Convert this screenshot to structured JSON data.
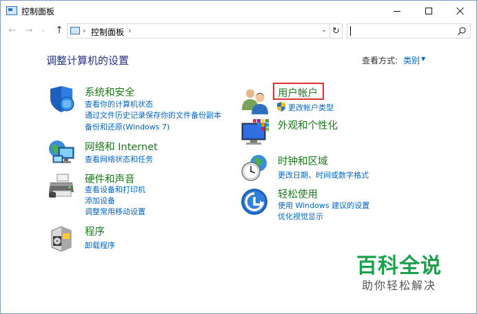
{
  "window": {
    "title": "控制面板"
  },
  "nav": {
    "address_path": "控制面板",
    "search_placeholder": ""
  },
  "header": {
    "title": "调整计算机的设置",
    "view_label": "查看方式:",
    "view_value": "类别"
  },
  "categories_left": [
    {
      "title": "系统和安全",
      "links": [
        "查看你的计算机状态",
        "通过文件历史记录保存你的文件备份副本",
        "备份和还原(Windows 7)"
      ]
    },
    {
      "title": "网络和 Internet",
      "links": [
        "查看网络状态和任务"
      ]
    },
    {
      "title": "硬件和声音",
      "links": [
        "查看设备和打印机",
        "添加设备",
        "调整常用移动设置"
      ]
    },
    {
      "title": "程序",
      "links": [
        "卸载程序"
      ]
    }
  ],
  "categories_right": [
    {
      "title": "用户帐户",
      "links": [
        "更改帐户类型"
      ]
    },
    {
      "title": "外观和个性化",
      "links": []
    },
    {
      "title": "时钟和区域",
      "links": [
        "更改日期、时间或数字格式"
      ]
    },
    {
      "title": "轻松使用",
      "links": [
        "使用 Windows 建议的设置",
        "优化视觉显示"
      ]
    }
  ],
  "watermark": {
    "brand": "百科全说",
    "tagline": "助你轻松解决"
  },
  "colors": {
    "category_title": "#1b7a1b",
    "link": "#0066cc",
    "page_title": "#1e3287",
    "highlight": "#e03030"
  }
}
